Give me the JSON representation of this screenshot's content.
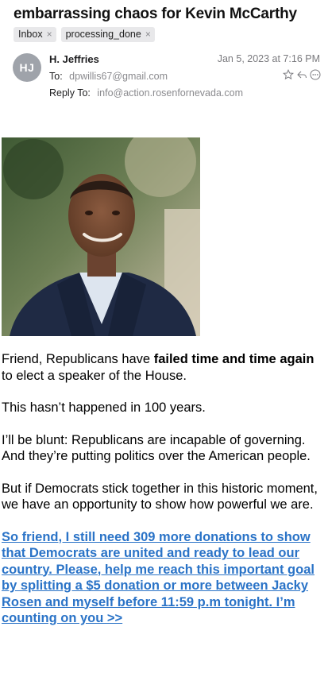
{
  "email": {
    "subject": "embarrassing chaos for Kevin McCarthy",
    "tags": [
      {
        "label": "Inbox",
        "remove_icon": "close-icon"
      },
      {
        "label": "processing_done",
        "remove_icon": "close-icon"
      }
    ],
    "avatar_initials": "HJ",
    "sender_name": "H. Jeffries",
    "date": "Jan 5, 2023 at 7:16 PM",
    "to_label": "To:",
    "to_address": "dpwillis67@gmail.com",
    "reply_to_label": "Reply To:",
    "reply_to_address": "info@action.rosenfornevada.com",
    "action_icons": [
      "star-icon",
      "reply-icon",
      "more-icon"
    ]
  },
  "body": {
    "p1_before": "Friend, Republicans have ",
    "p1_bold": "failed time and time again",
    "p1_after": " to elect a speaker of the House.",
    "p2": "This hasn’t happened in 100 years.",
    "p3": "I’ll be blunt: Republicans are incapable of governing. And they’re putting politics over the American people.",
    "p4": "But if Democrats stick together in this historic moment, we have an opportunity to show how powerful we are.",
    "cta": "So friend, I still need 309 more donations to show that Democrats are united and ready to lead our country. Please, help me reach this important goal by splitting a $5 donation or more between Jacky Rosen and myself before 11:59 p.m tonight. I’m counting on you >>"
  },
  "colors": {
    "link": "#2a73c7",
    "avatar_bg": "#9fa3aa",
    "tag_bg": "#e8e8ea"
  }
}
